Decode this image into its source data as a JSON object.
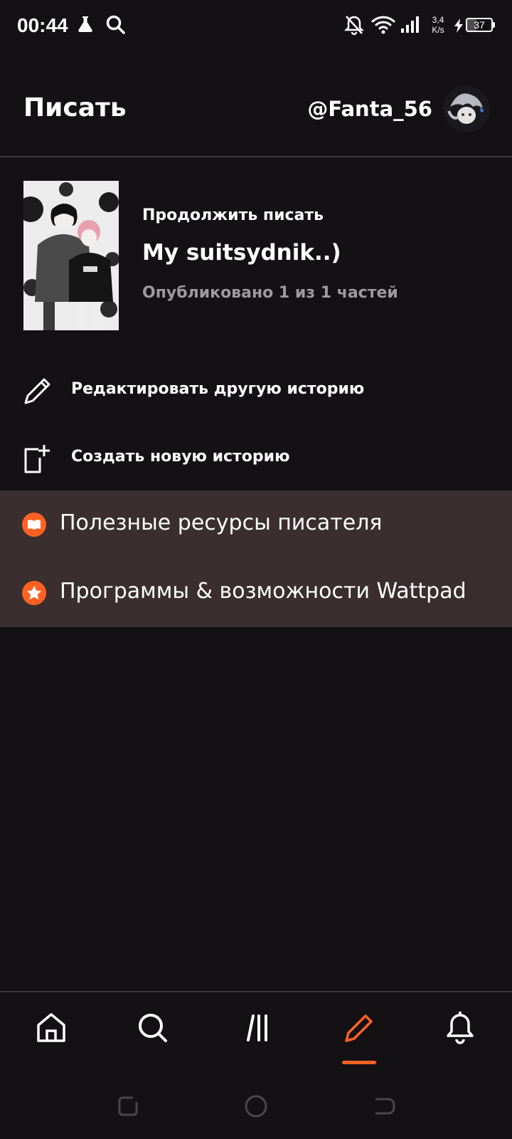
{
  "status_bar": {
    "time": "00:44",
    "speed_value": "3,4",
    "speed_unit": "K/s",
    "battery": "37",
    "battery_fraction": 0.37,
    "icons": [
      "flask-icon",
      "search-icon",
      "bell-off-icon",
      "wifi-icon",
      "signal-icon",
      "charging-icon",
      "battery-icon"
    ]
  },
  "header": {
    "title": "Писать",
    "username": "@Fanta_56"
  },
  "continue_writing": {
    "label": "Продолжить писать",
    "story_title": "My suitsydnik..)",
    "parts_info": "Опубликовано 1 из 1 частей"
  },
  "actions": [
    {
      "label": "Редактировать другую историю",
      "icon": "pencil-icon"
    },
    {
      "label": "Создать новую историю",
      "icon": "new-story-icon"
    }
  ],
  "resources": [
    {
      "label": "Полезные ресурсы писателя",
      "icon": "book-icon"
    },
    {
      "label": "Программы & возможности Wattpad",
      "icon": "star-icon"
    }
  ],
  "bottom_nav": {
    "items": [
      "home-icon",
      "search-icon",
      "library-icon",
      "write-icon",
      "notifications-icon"
    ],
    "active": "write-icon"
  },
  "colors": {
    "background": "#141114",
    "accent": "#ff6122",
    "resources_panel": "#3b2e2e",
    "muted_text": "#9d9a9d"
  }
}
